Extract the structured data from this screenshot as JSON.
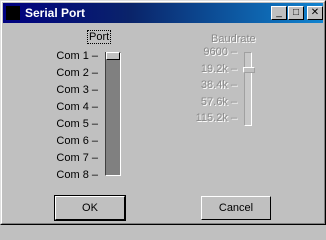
{
  "window": {
    "title": "Serial Port"
  },
  "caption_buttons": {
    "minimize": "_",
    "maximize": "□",
    "close": "✕"
  },
  "port": {
    "label": "Port",
    "ticks": [
      "Com 1",
      "Com 2",
      "Com 3",
      "Com 4",
      "Com 5",
      "Com 6",
      "Com 7",
      "Com 8"
    ],
    "selected": "Com 1",
    "enabled": true
  },
  "baudrate": {
    "label": "Baudrate",
    "ticks": [
      "9600",
      "19.2k",
      "38.4k",
      "57.6k",
      "115.2k"
    ],
    "selected": "19.2k",
    "enabled": false
  },
  "buttons": {
    "ok": "OK",
    "cancel": "Cancel"
  }
}
